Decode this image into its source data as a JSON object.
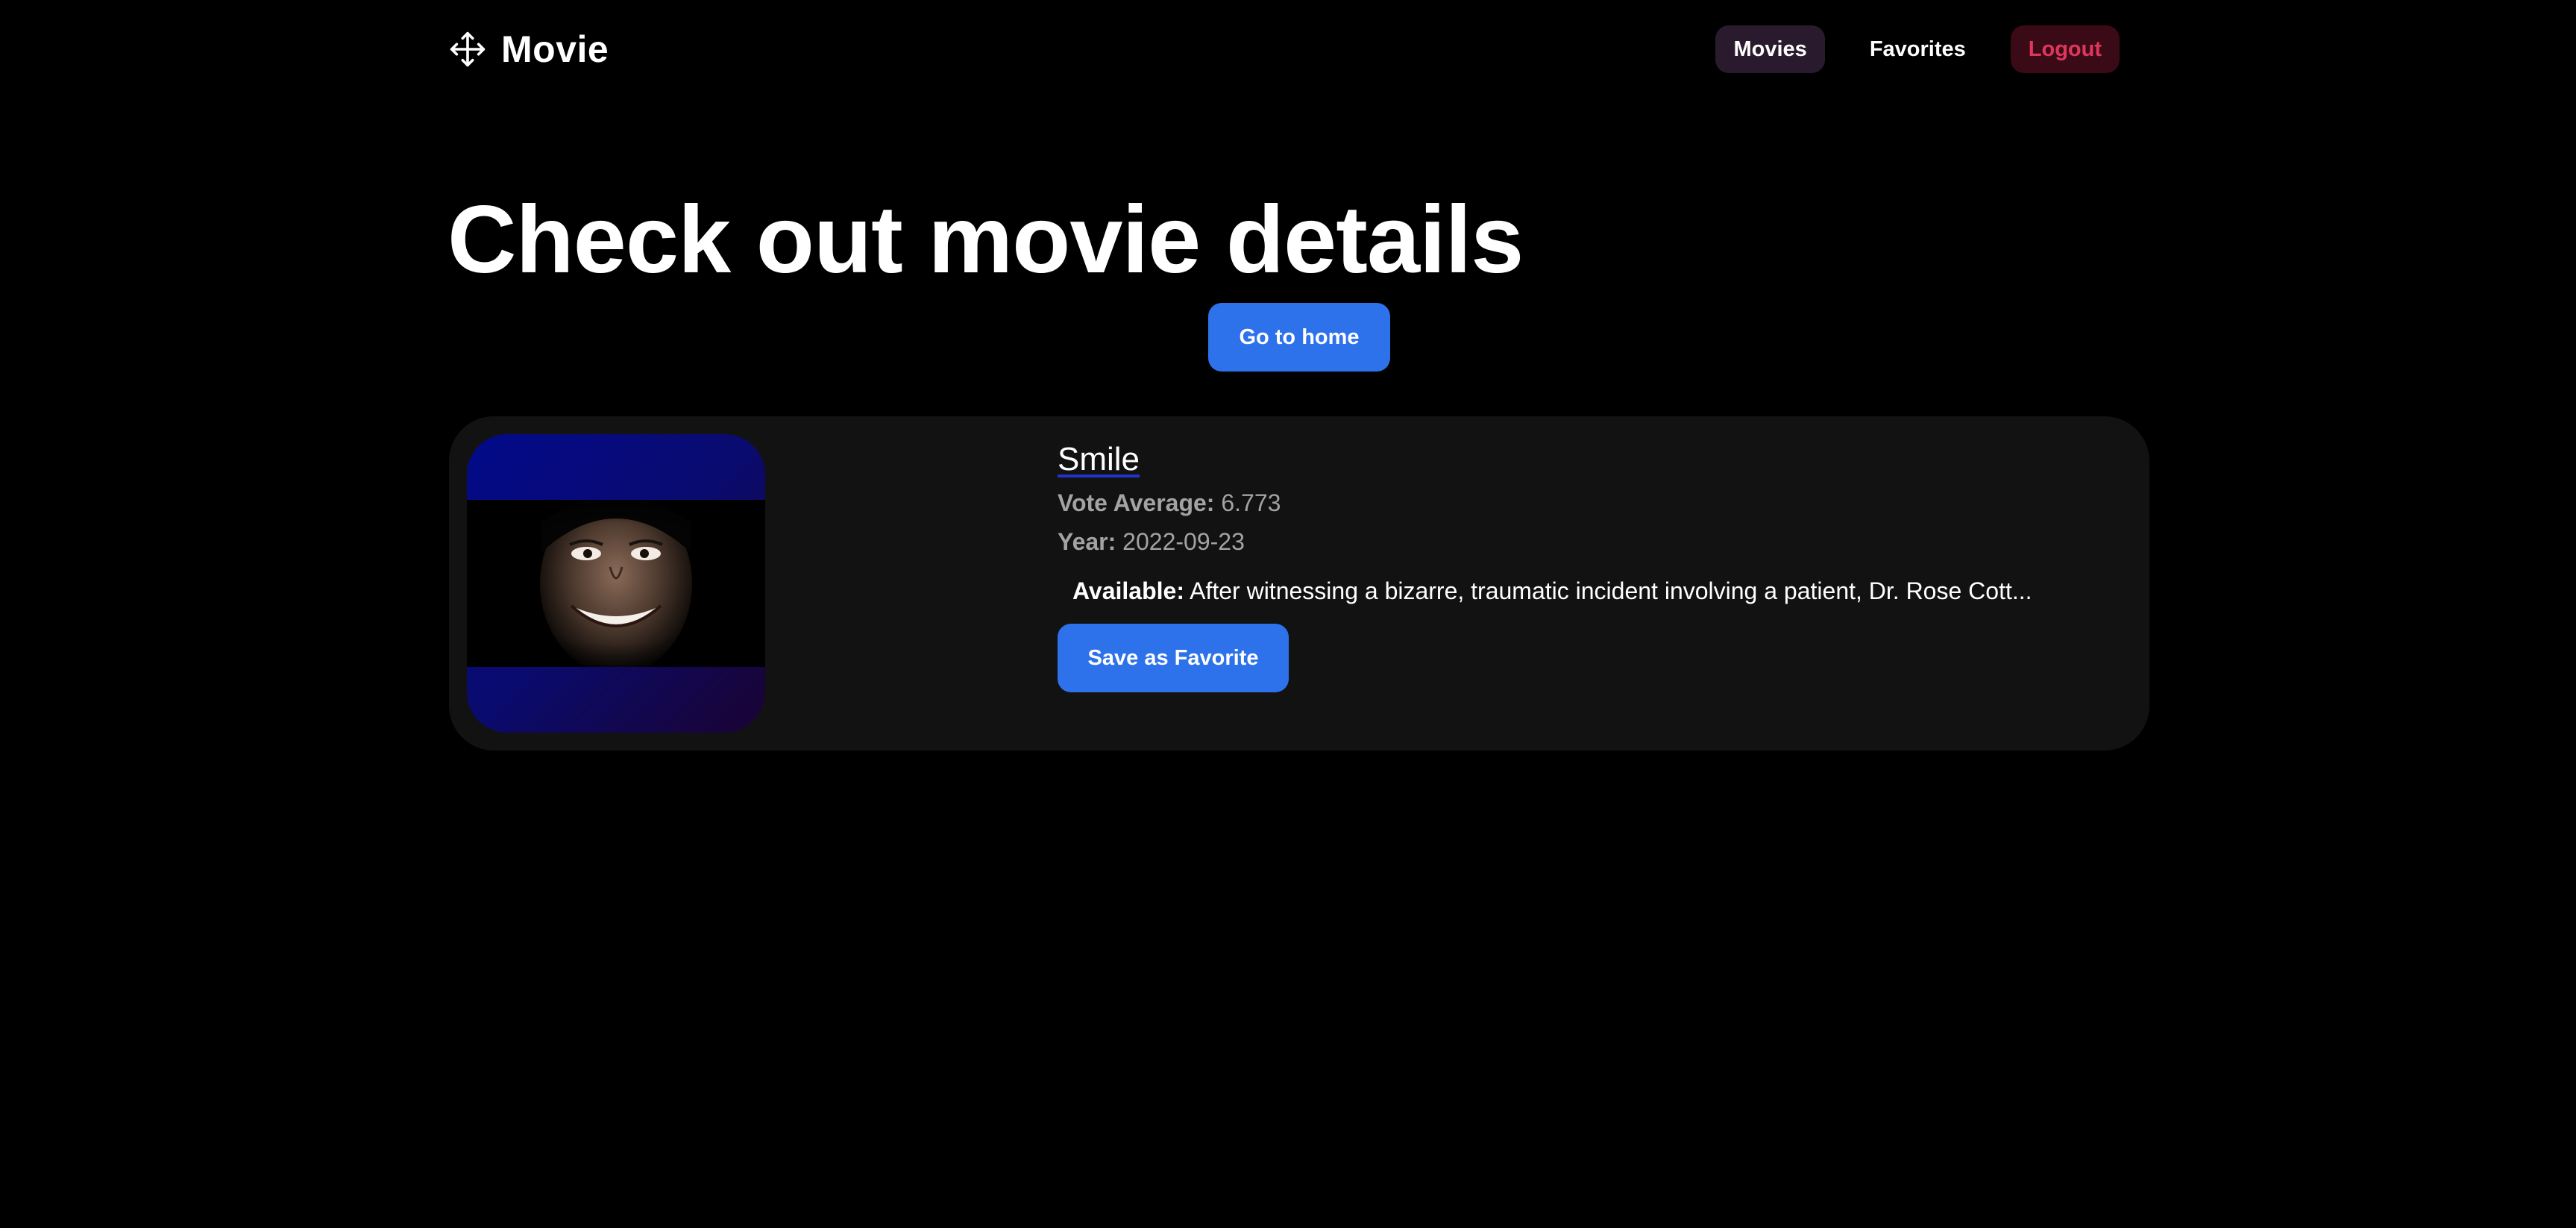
{
  "header": {
    "brand_icon": "move-arrows-icon",
    "brand_name": "Movie",
    "nav": {
      "movies_label": "Movies",
      "favorites_label": "Favorites",
      "logout_label": "Logout"
    }
  },
  "hero": {
    "title": "Check out movie details",
    "home_button_label": "Go to home"
  },
  "movie": {
    "title": "Smile",
    "vote_average_label": "Vote Average:",
    "vote_average_value": "6.773",
    "year_label": "Year:",
    "year_value": "2022-09-23",
    "available_label": "Available:",
    "overview_text": "After witnessing a bizarre, traumatic incident involving a patient, Dr. Rose Cott...",
    "save_button_label": "Save as Favorite"
  },
  "colors": {
    "background": "#000000",
    "card": "#121212",
    "primary_button": "#2d72ea",
    "active_nav_bg": "#2a1a2e",
    "logout_bg": "#3a0a16",
    "logout_text": "#e0365d",
    "muted_text": "#a3a3a3"
  }
}
